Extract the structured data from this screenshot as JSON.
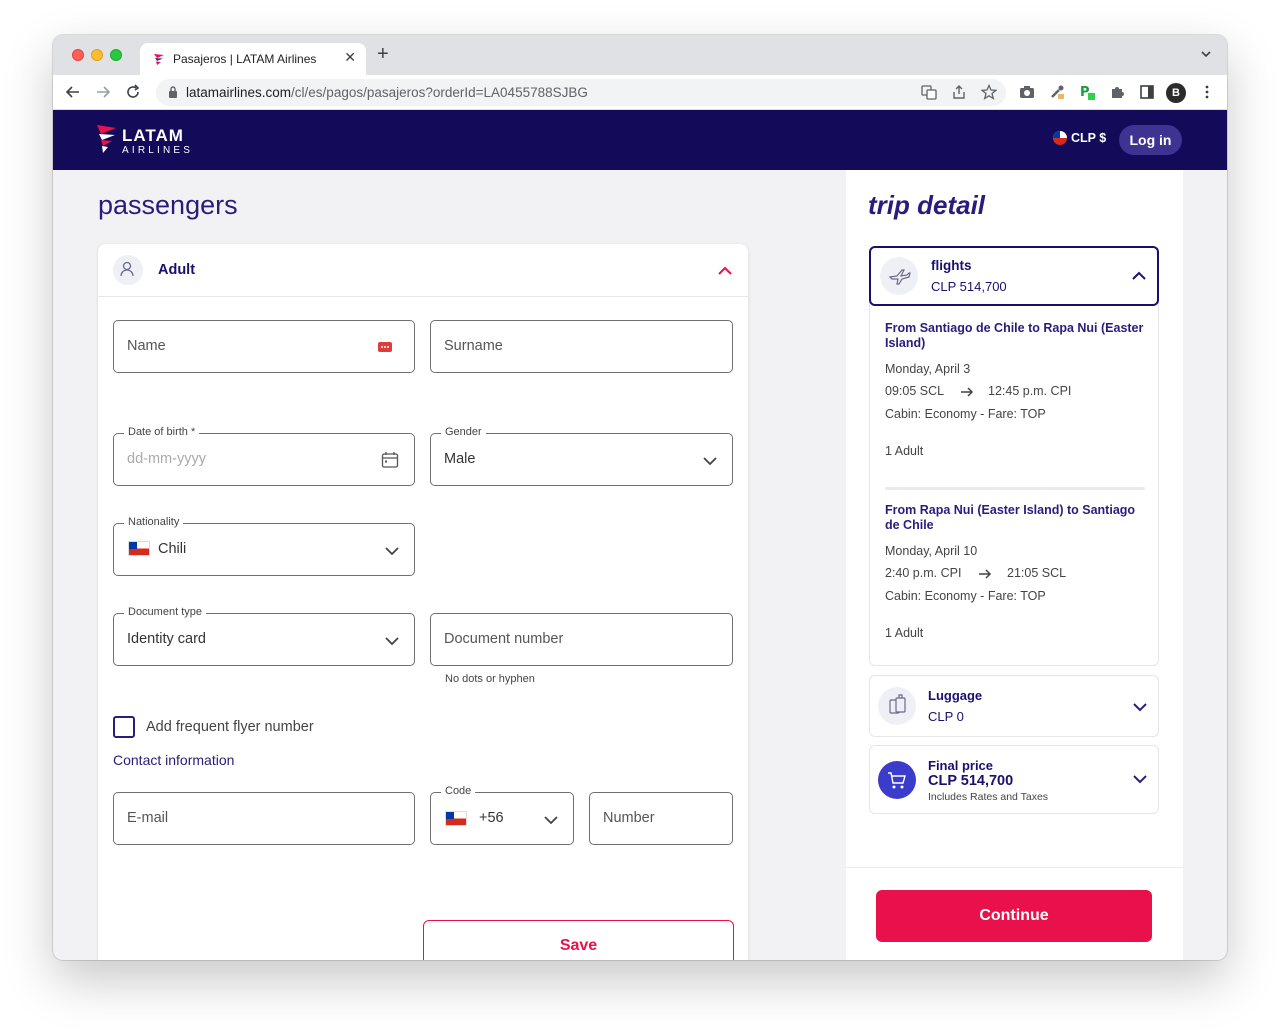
{
  "browser": {
    "tab_title": "Pasajeros | LATAM Airlines",
    "url_host": "latamairlines.com",
    "url_path": "/cl/es/pagos/pasajeros?orderId=LA0455788SJBG",
    "profile_initial": "B"
  },
  "header": {
    "logo_word": "LATAM",
    "logo_sub": "AIRLINES",
    "currency": "CLP $",
    "login_label": "Log in"
  },
  "passengers": {
    "title": "passengers",
    "section_label": "Adult",
    "name_placeholder": "Name",
    "surname_placeholder": "Surname",
    "dob_label": "Date of birth *",
    "dob_placeholder": "dd-mm-yyyy",
    "gender_label": "Gender",
    "gender_value": "Male",
    "nationality_label": "Nationality",
    "nationality_value": "Chili",
    "doctype_label": "Document type",
    "doctype_value": "Identity card",
    "docnumber_placeholder": "Document number",
    "docnumber_helper": "No dots or hyphen",
    "frequent_flyer_label": "Add frequent flyer number",
    "contact_label": "Contact information",
    "email_placeholder": "E-mail",
    "code_label": "Code",
    "code_value": "+56",
    "phone_placeholder": "Number",
    "save_label": "Save"
  },
  "trip": {
    "title": "trip detail",
    "flights": {
      "title": "flights",
      "price": "CLP 514,700",
      "segments": [
        {
          "title": "From Santiago de Chile to Rapa Nui (Easter Island)",
          "date": "Monday, April 3",
          "depart": "09:05 SCL",
          "arrive": "12:45 p.m. CPI",
          "cabin": "Cabin: Economy - Fare: TOP",
          "pax": "1 Adult"
        },
        {
          "title": "From Rapa Nui (Easter Island) to Santiago de Chile",
          "date": "Monday, April 10",
          "depart": "2:40 p.m. CPI",
          "arrive": "21:05 SCL",
          "cabin": "Cabin: Economy - Fare: TOP",
          "pax": "1 Adult"
        }
      ]
    },
    "luggage": {
      "title": "Luggage",
      "price": "CLP 0"
    },
    "final": {
      "title": "Final price",
      "price": "CLP 514,700",
      "note": "Includes Rates and Taxes"
    },
    "continue_label": "Continue"
  },
  "colors": {
    "brand_navy": "#130a5a",
    "accent_red": "#e8114b",
    "text_indigo": "#2a1c7d"
  }
}
